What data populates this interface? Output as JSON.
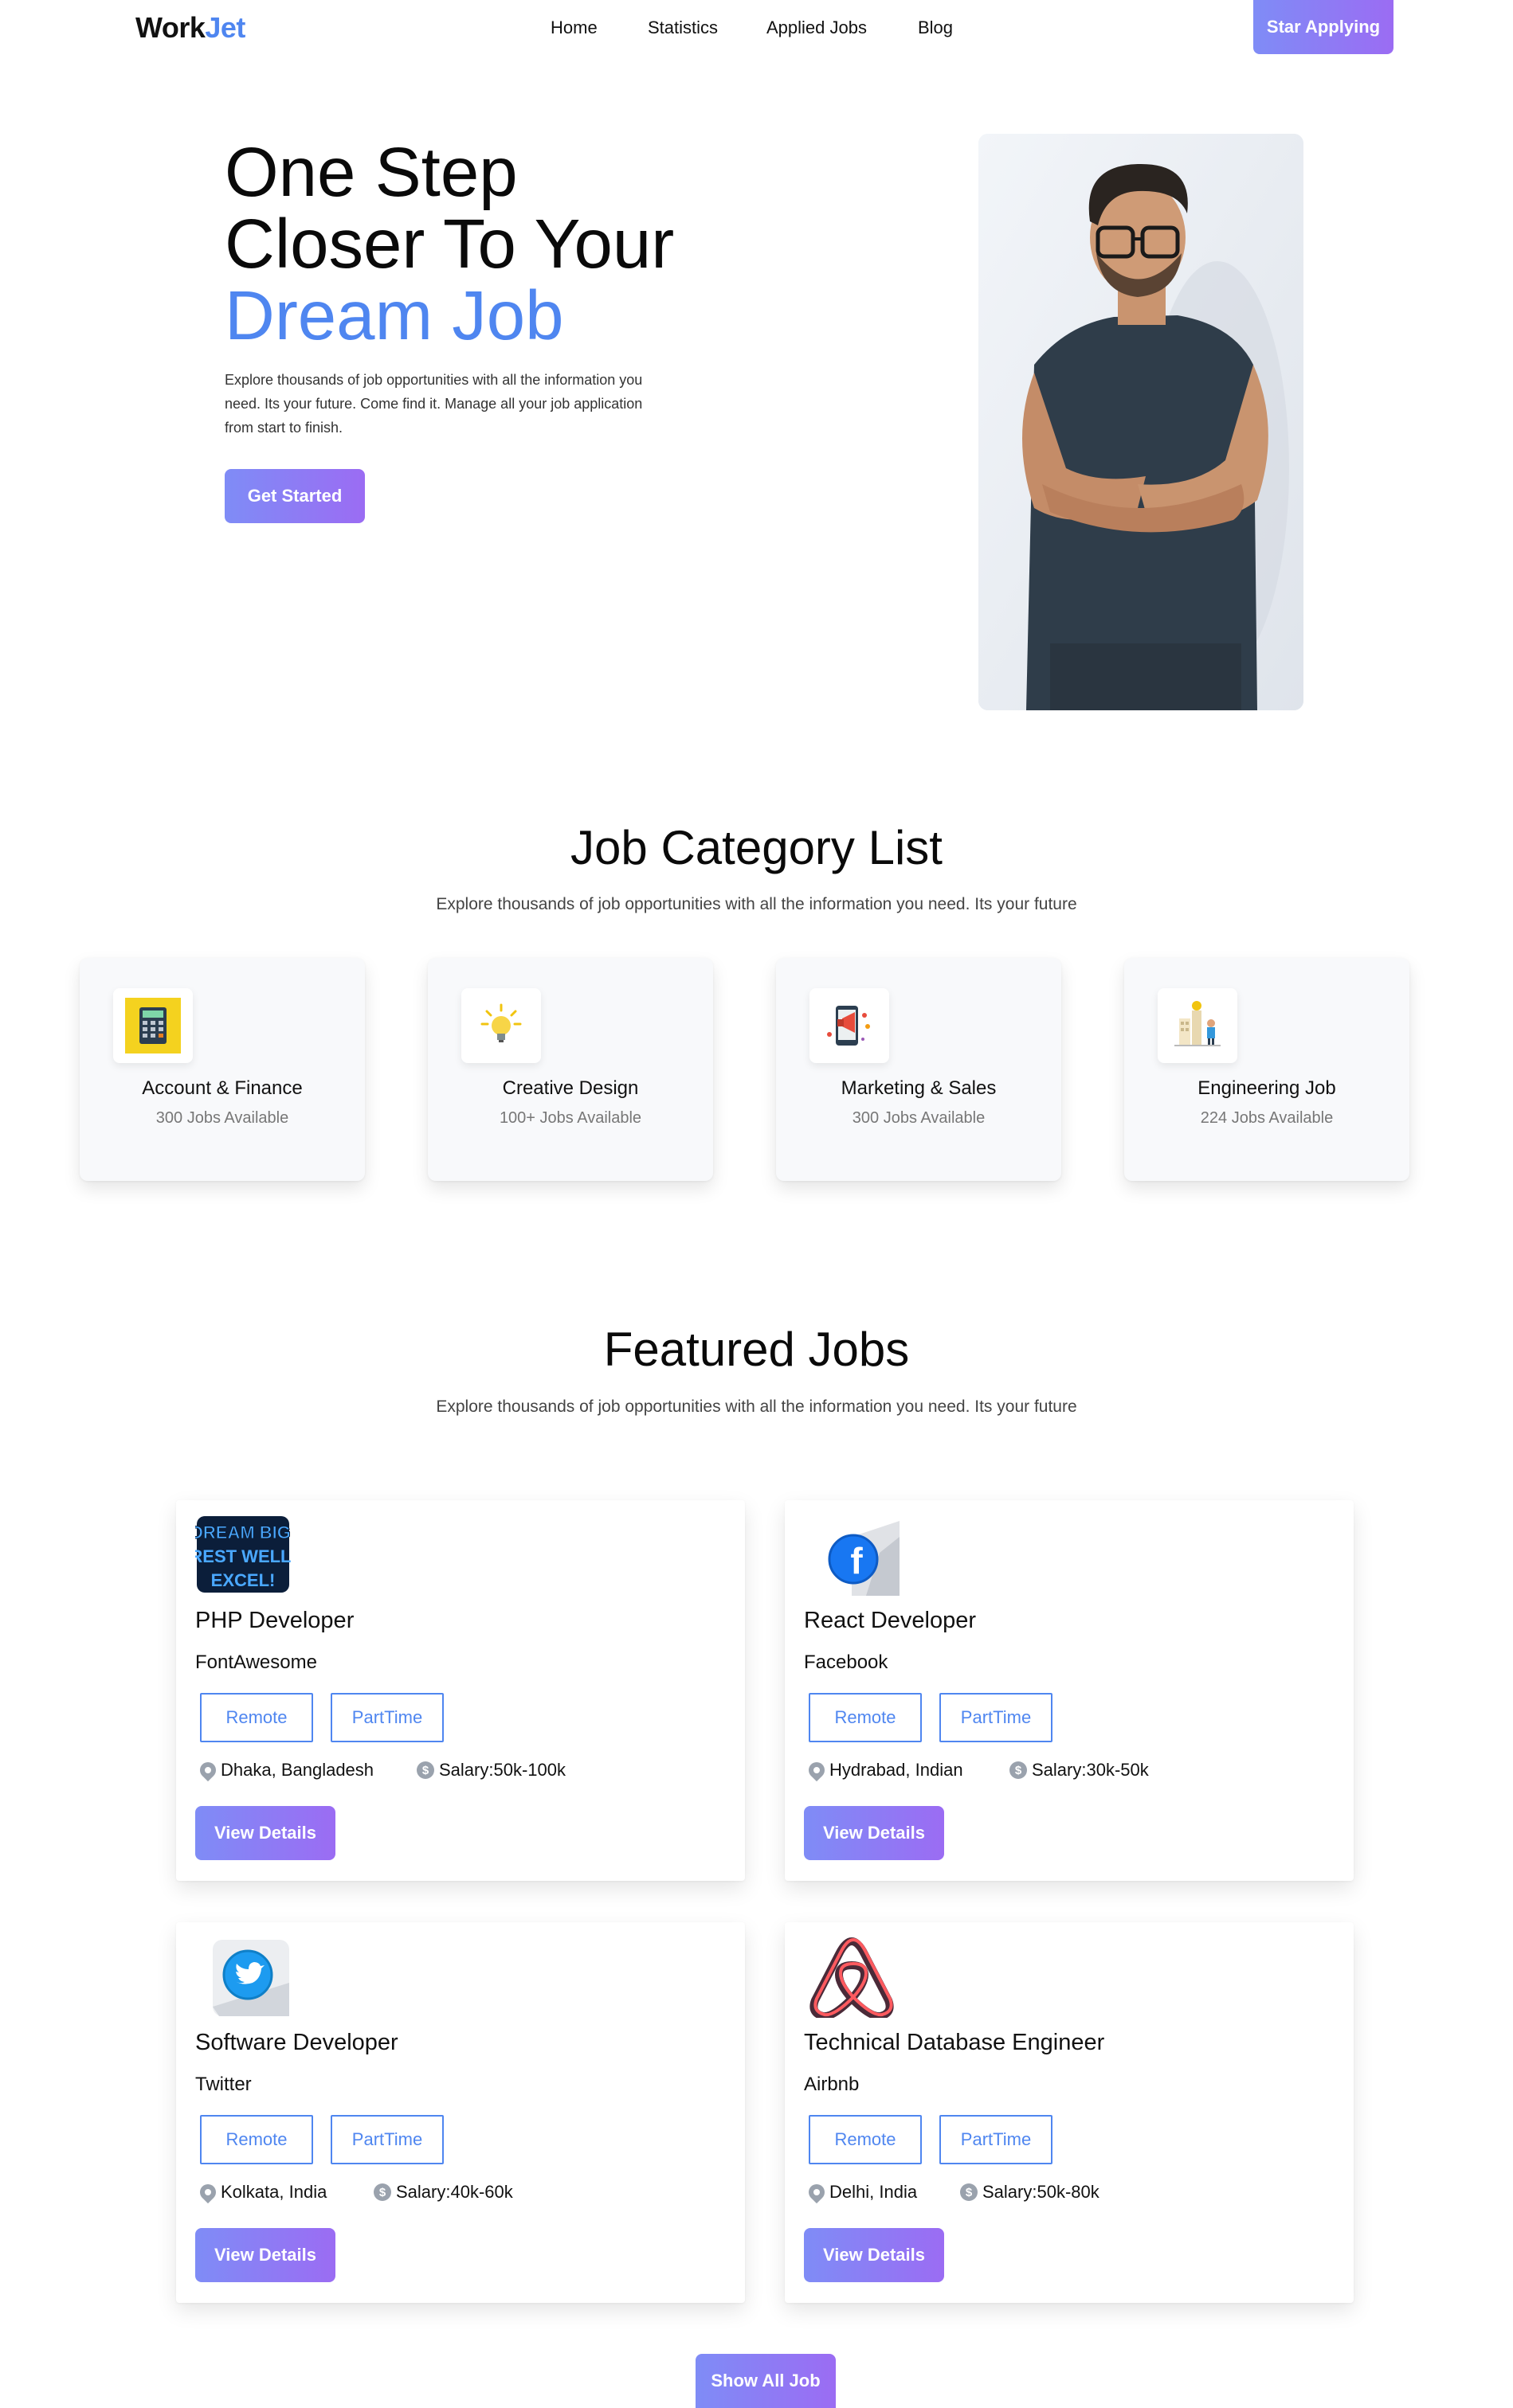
{
  "nav": {
    "logo_main": "Work",
    "logo_accent": "Jet",
    "links": [
      "Home",
      "Statistics",
      "Applied Jobs",
      "Blog"
    ],
    "cta": "Star Applying"
  },
  "hero": {
    "title_line1": "One Step",
    "title_line2": "Closer To Your",
    "title_line3": "Dream Job",
    "description": "Explore thousands of job opportunities with all the information you need. Its your future. Come find it. Manage all your job application from start to finish.",
    "button": "Get Started"
  },
  "categories": {
    "title": "Job Category List",
    "subtitle": "Explore thousands of job opportunities with all the information you need. Its your future",
    "items": [
      {
        "name": "Account & Finance",
        "count": "300 Jobs Available",
        "icon": "calculator-icon"
      },
      {
        "name": "Creative Design",
        "count": "100+ Jobs Available",
        "icon": "lightbulb-icon"
      },
      {
        "name": "Marketing & Sales",
        "count": "300 Jobs Available",
        "icon": "megaphone-icon"
      },
      {
        "name": "Engineering Job",
        "count": "224 Jobs Available",
        "icon": "engineer-icon"
      }
    ]
  },
  "featured": {
    "title": "Featured Jobs",
    "subtitle": "Explore thousands of job opportunities with all the information you need. Its your future",
    "jobs": [
      {
        "title": "PHP Developer",
        "company": "FontAwesome",
        "tag1": "Remote",
        "tag2": "PartTime",
        "location": "Dhaka, Bangladesh",
        "salary": "Salary:50k-100k",
        "button": "View Details",
        "logo_text": "DREAM BIG, REST WELL, EXCEL!"
      },
      {
        "title": "React Developer",
        "company": "Facebook",
        "tag1": "Remote",
        "tag2": "PartTime",
        "location": "Hydrabad, Indian",
        "salary": "Salary:30k-50k",
        "button": "View Details"
      },
      {
        "title": "Software Developer",
        "company": "Twitter",
        "tag1": "Remote",
        "tag2": "PartTime",
        "location": "Kolkata, India",
        "salary": "Salary:40k-60k",
        "button": "View Details"
      },
      {
        "title": "Technical Database Engineer",
        "company": "Airbnb",
        "tag1": "Remote",
        "tag2": "PartTime",
        "location": "Delhi, India",
        "salary": "Salary:50k-80k",
        "button": "View Details"
      }
    ],
    "show_all": "Show All Job"
  },
  "colors": {
    "accent": "#4f86f0",
    "button_start": "#7f8cf6",
    "button_end": "#9b6cf3"
  }
}
